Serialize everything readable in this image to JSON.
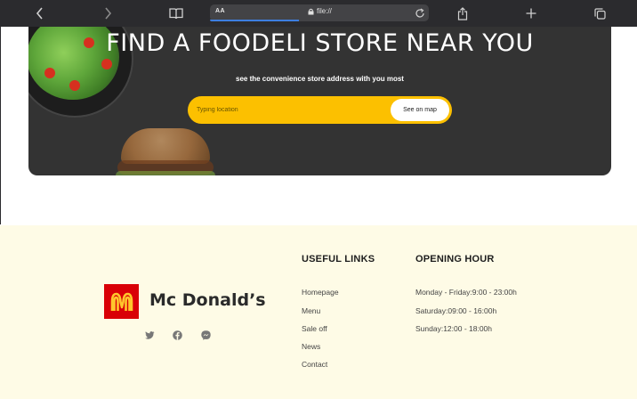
{
  "browser": {
    "text_size_label": "AA",
    "url": "file://"
  },
  "hero": {
    "title": "FIND A FOODELI STORE NEAR YOU",
    "subtitle": "see the convenience store address with you most",
    "search_placeholder": "Typing location",
    "map_button": "See on map"
  },
  "footer": {
    "brand": "Mc Donald’s",
    "social_icons": [
      "twitter-icon",
      "facebook-icon",
      "messenger-icon"
    ],
    "useful_links": {
      "title": "USEFUL LINKS",
      "items": [
        "Homepage",
        "Menu",
        "Sale off",
        "News",
        "Contact"
      ]
    },
    "opening_hour": {
      "title": "OPENING HOUR",
      "items": [
        "Monday - Friday:9:00 - 23:00h",
        "Saturday:09:00 - 16:00h",
        "Sunday:12:00 - 18:00h"
      ]
    }
  },
  "colors": {
    "toolbar": "#2b2b2e",
    "hero_bg": "#333333",
    "accent": "#fcc000",
    "footer_bg": "#fefbe6",
    "logo_red": "#d90007"
  }
}
